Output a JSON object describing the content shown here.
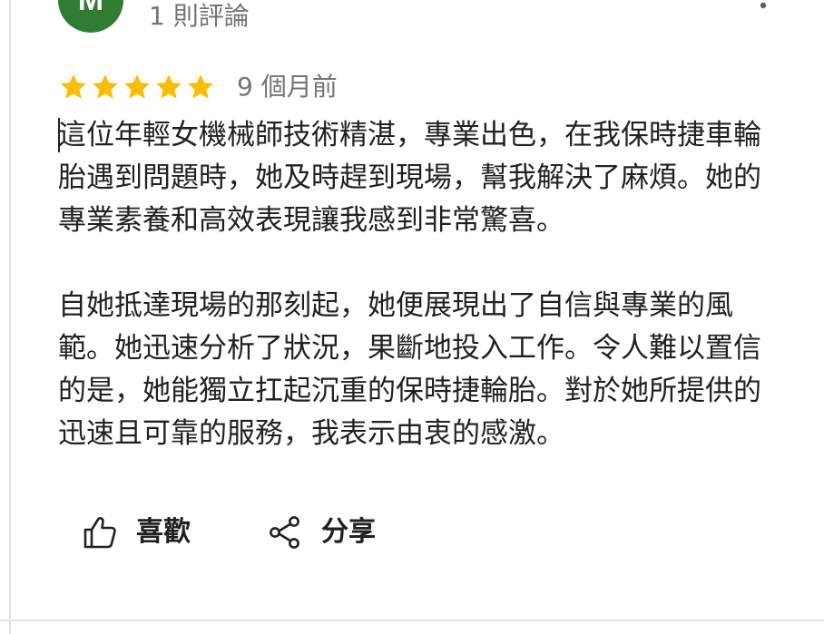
{
  "reviewer": {
    "avatar_letter": "M",
    "avatar_color": "#2e7d32",
    "review_count": "1 則評論"
  },
  "review": {
    "rating": 5,
    "max_rating": 5,
    "star_color": "#fbbc04",
    "date": "9 個月前",
    "paragraphs": [
      "這位年輕女機械師技術精湛，專業出色，在我保時捷車輪\n胎遇到問題時，她及時趕到現場，幫我解決了麻煩。她的\n專業素養和高效表現讓我感到非常驚喜。",
      "自她抵達現場的那刻起，她便展現出了自信與專業的風\n範。她迅速分析了狀況，果斷地投入工作。令人難以置信\n的是，她能獨立扛起沉重的保時捷輪胎。對於她所提供的\n迅速且可靠的服務，我表示由衷的感激。"
    ]
  },
  "actions": {
    "like_label": "喜歡",
    "like_icon": "thumbs-up-icon",
    "share_label": "分享",
    "share_icon": "share-icon"
  },
  "menu": {
    "icon": "more-vertical-icon"
  }
}
